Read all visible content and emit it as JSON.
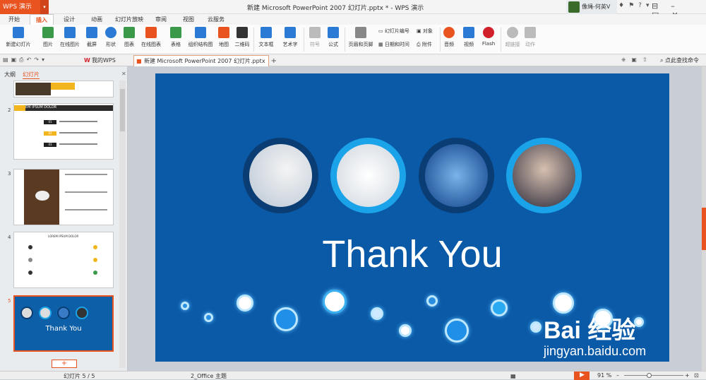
{
  "app": {
    "name": "WPS 演示",
    "doc_title": "新建 Microsoft PowerPoint 2007 幻灯片.pptx * - WPS 演示",
    "user": "像绳-何英V"
  },
  "menu": {
    "tabs": [
      "开始",
      "插入",
      "设计",
      "动画",
      "幻灯片放映",
      "审阅",
      "视图",
      "云服务"
    ],
    "active": "插入"
  },
  "ribbon": {
    "items": [
      {
        "label": "新建幻灯片",
        "icon": "new-slide-icon",
        "color": "#2b7bd4"
      },
      {
        "label": "图片",
        "icon": "picture-icon",
        "color": "#3a9a4a"
      },
      {
        "label": "在线图片",
        "icon": "online-picture-icon",
        "color": "#2b7bd4"
      },
      {
        "label": "截屏",
        "icon": "screenshot-icon",
        "color": "#2b7bd4"
      },
      {
        "label": "形状",
        "icon": "shape-icon",
        "color": "#2b7bd4"
      },
      {
        "label": "图表",
        "icon": "chart-icon",
        "color": "#3a9a4a"
      },
      {
        "label": "在线图表",
        "icon": "online-chart-icon",
        "color": "#e8531f"
      },
      {
        "label": "表格",
        "icon": "table-icon",
        "color": "#3a9a4a"
      },
      {
        "label": "组织结构图",
        "icon": "org-chart-icon",
        "color": "#2b7bd4"
      },
      {
        "label": "地图",
        "icon": "map-icon",
        "color": "#e8531f"
      },
      {
        "label": "二维码",
        "icon": "qrcode-icon",
        "color": "#333333"
      },
      {
        "label": "文本框",
        "icon": "textbox-icon",
        "color": "#2b7bd4"
      },
      {
        "label": "艺术字",
        "icon": "wordart-icon",
        "color": "#2b7bd4"
      },
      {
        "label": "符号",
        "icon": "symbol-icon",
        "color": "#999999"
      },
      {
        "label": "公式",
        "icon": "formula-icon",
        "color": "#2b7bd4"
      },
      {
        "label": "页眉和页脚",
        "icon": "header-footer-icon",
        "color": "#666666"
      },
      {
        "label": "音频",
        "icon": "audio-icon",
        "color": "#e8531f"
      },
      {
        "label": "视频",
        "icon": "video-icon",
        "color": "#2b7bd4"
      },
      {
        "label": "Flash",
        "icon": "flash-icon",
        "color": "#d0202a"
      },
      {
        "label": "超链接",
        "icon": "hyperlink-icon",
        "color": "#aaaaaa"
      },
      {
        "label": "动作",
        "icon": "action-icon",
        "color": "#aaaaaa"
      }
    ],
    "small": [
      {
        "label": "幻灯片编号",
        "icon": "slide-number-icon"
      },
      {
        "label": "对象",
        "icon": "object-icon"
      },
      {
        "label": "日期和时间",
        "icon": "datetime-icon"
      },
      {
        "label": "附件",
        "icon": "attachment-icon"
      }
    ]
  },
  "tabs": {
    "my_wps": "我的WPS",
    "doc": "新建 Microsoft PowerPoint 2007 幻灯片.pptx *",
    "find": "点此查找命令"
  },
  "panel": {
    "outline": "大纲",
    "slides": "幻灯片",
    "slide_numbers": [
      "2",
      "3",
      "4",
      "5"
    ]
  },
  "thumbs": {
    "s2_title": "LOREM IPSUM DOLOR",
    "s2_steps": [
      "01",
      "02",
      "03"
    ],
    "s4_title": "LOREM IPSUM DOLOR",
    "s5_title": "Thank You"
  },
  "slide": {
    "title": "Thank You"
  },
  "status": {
    "slide_info": "幻灯片 5 / 5",
    "theme": "2_Office 主题",
    "zoom": "91 %"
  },
  "watermark": {
    "text": "Bai 经验",
    "sub": "jingyan.baidu.com"
  }
}
